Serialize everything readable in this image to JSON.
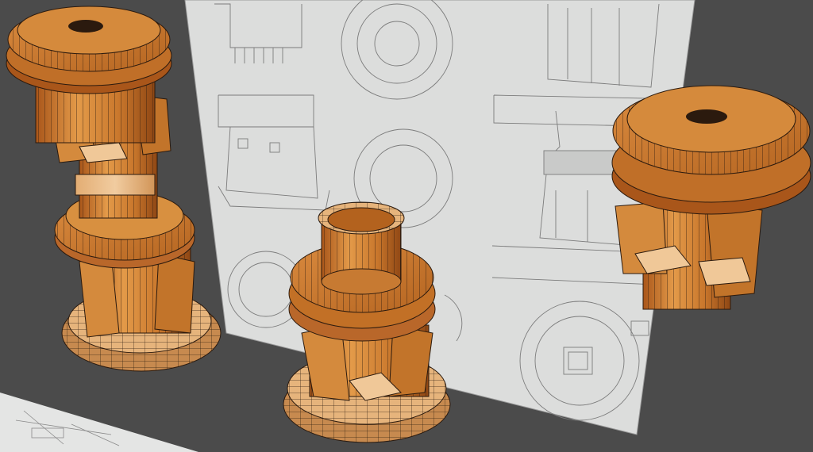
{
  "viewport": {
    "background": "#4b4b4b",
    "ground_sheet_color": "#e6e7e6",
    "blueprint_color": "#dcdddc",
    "line_color": "#7a7a7a"
  },
  "materials": {
    "wood_dark": "#b8651f",
    "wood_mid": "#d8883a",
    "wood_light": "#e9b16e",
    "wood_pale": "#f0c898",
    "edge": "#2b1a0e"
  },
  "models": [
    {
      "name": "tall-double-pillar"
    },
    {
      "name": "open-top-pillar"
    },
    {
      "name": "capped-short-pillar"
    }
  ]
}
